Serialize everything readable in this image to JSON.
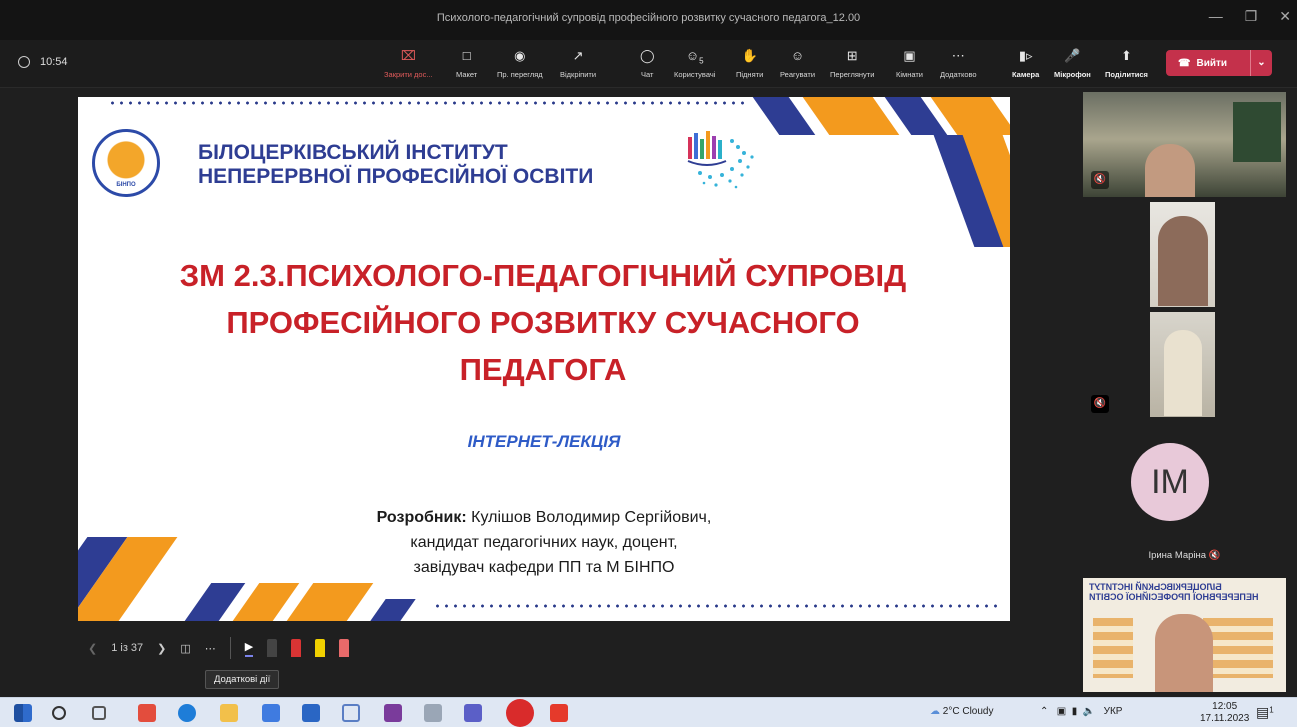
{
  "window": {
    "title": "Психолого-педагогічний супровід професійного розвитку сучасного педагога_12.00"
  },
  "call": {
    "elapsed": "10:54"
  },
  "toolbar": {
    "close_sharing": "Закрити дос...",
    "layout": "Макет",
    "presenter_view": "Пр. перегляд",
    "pop_out": "Відкріпити",
    "chat": "Чат",
    "people": "Користувачі",
    "people_count": "5",
    "raise_hand": "Підняти",
    "react": "Реагувати",
    "view": "Переглянути",
    "rooms": "Кімнати",
    "more": "Додатково",
    "camera": "Камера",
    "mic": "Мікрофон",
    "share": "Поділитися",
    "leave": "Вийти"
  },
  "slide": {
    "institute_line1": "БІЛОЦЕРКІВСЬКИЙ ІНСТИТУТ",
    "institute_line2": "НЕПЕРЕРВНОЇ ПРОФЕСІЙНОЇ ОСВІТИ",
    "logo_text": "БІНПО",
    "title_line1": "ЗМ 2.3.ПСИХОЛОГО-ПЕДАГОГІЧНИЙ СУПРОВІД",
    "title_line2": "ПРОФЕСІЙНОГО РОЗВИТКУ СУЧАСНОГО",
    "title_line3": "ПЕДАГОГА",
    "subtitle": "ІНТЕРНЕТ-ЛЕКЦІЯ",
    "author_label": "Розробник:",
    "author_name": " Кулішов Володимир Сергійович,",
    "author_line2": "кандидат педагогічних наук, доцент,",
    "author_line3": "завідувач кафедри ПП та М БІНПО"
  },
  "presenter": {
    "page_indicator": "1 із 37",
    "tooltip": "Додаткові дії",
    "colors": {
      "pen1": "#333333",
      "pen2": "#d93434",
      "pen3": "#f0d000",
      "pen4": "#e86a6a"
    }
  },
  "participants": {
    "avatar_initials": "ІМ",
    "avatar_name": "Ірина Маріна"
  },
  "taskbar": {
    "weather": "2°C Cloudy",
    "lang": "УКР",
    "time": "12:05",
    "date": "17.11.2023",
    "notif_count": "1"
  },
  "colors": {
    "brand_blue": "#2e3d93",
    "title_red": "#c82128",
    "accent_orange": "#f39a1e",
    "leave_red": "#c4314b"
  }
}
